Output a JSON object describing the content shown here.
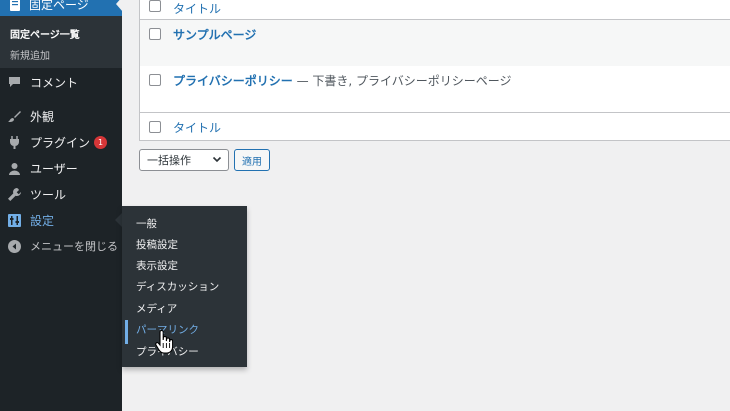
{
  "sidebar": {
    "pages_label": "固定ページ",
    "sub_items": [
      "固定ページ一覧",
      "新規追加"
    ],
    "items": [
      {
        "label": "コメント",
        "icon": "comment-icon"
      },
      {
        "label": "外観",
        "icon": "paintbrush-icon"
      },
      {
        "label": "プラグイン",
        "icon": "plugin-icon",
        "badge": "1"
      },
      {
        "label": "ユーザー",
        "icon": "user-icon"
      },
      {
        "label": "ツール",
        "icon": "wrench-icon"
      },
      {
        "label": "設定",
        "icon": "settings-icon"
      }
    ],
    "collapse_label": "メニューを閉じる"
  },
  "table": {
    "header_col": "タイトル",
    "rows": [
      {
        "title": "サンプルページ",
        "state": ""
      },
      {
        "title": "プライバシーポリシー",
        "state": "— 下書き, プライバシーポリシーページ"
      }
    ],
    "footer_col": "タイトル"
  },
  "bulk": {
    "select_value": "一括操作",
    "apply_label": "適用"
  },
  "flyout": {
    "items": [
      "一般",
      "投稿設定",
      "表示設定",
      "ディスカッション",
      "メディア",
      "パーマリンク",
      "プライバシー"
    ]
  },
  "colors": {
    "sidebar_bg": "#1d2327",
    "accent": "#2271b1",
    "highlight": "#72aee6",
    "badge": "#d63638"
  }
}
